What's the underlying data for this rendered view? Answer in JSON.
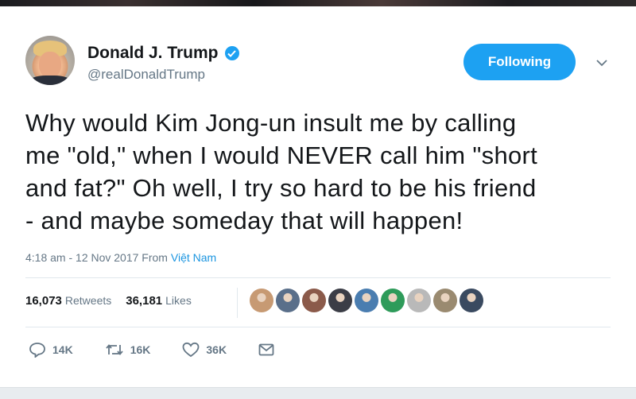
{
  "tweet": {
    "author_name": "Donald J. Trump",
    "handle": "@realDonaldTrump",
    "follow_label": "Following",
    "text_lines": [
      "Why would Kim Jong-un insult me by calling",
      "me \"old,\" when I would NEVER call him \"short",
      "and fat?\" Oh well, I try so hard to be his friend",
      "- and maybe someday that will happen!"
    ],
    "timestamp": "4:18 am - 12 Nov 2017 From ",
    "location": "Việt Nam",
    "retweets_count": "16,073",
    "retweets_label": "Retweets",
    "likes_count": "36,181",
    "likes_label": "Likes",
    "reply_count": "14K",
    "retweet_action_count": "16K",
    "like_action_count": "36K"
  },
  "icons": {
    "verified": "verified-badge-icon",
    "caret": "chevron-down-icon",
    "reply": "reply-icon",
    "retweet": "retweet-icon",
    "like": "heart-icon",
    "message": "envelope-icon"
  },
  "colors": {
    "accent": "#1da1f2",
    "muted": "#657786",
    "text": "#14171a",
    "link": "#1b95e0"
  },
  "likers_colors": [
    "#c79a73",
    "#5a6f8a",
    "#8b5a4a",
    "#3b3d46",
    "#4a7db0",
    "#2e9b5a",
    "#b9b9b9",
    "#9a8a70",
    "#3a4a60"
  ]
}
